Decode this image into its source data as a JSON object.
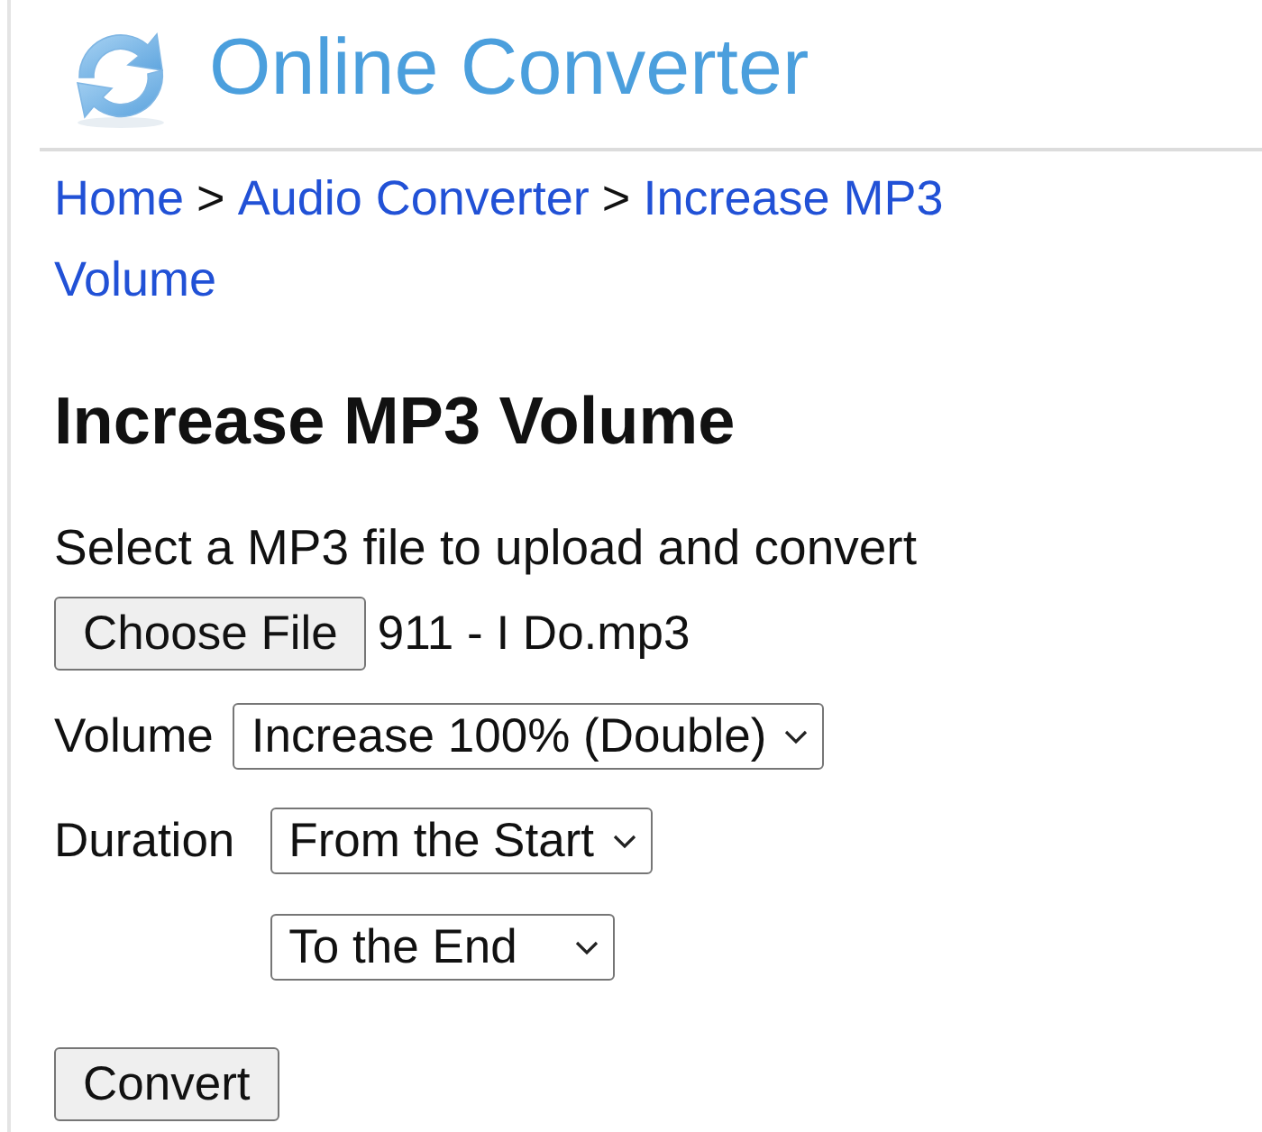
{
  "header": {
    "title": "Online Converter"
  },
  "breadcrumb": [
    {
      "kind": "link",
      "label": "Home"
    },
    {
      "kind": "separator",
      "label": ">"
    },
    {
      "kind": "link",
      "label": "Audio Converter"
    },
    {
      "kind": "separator",
      "label": ">"
    },
    {
      "kind": "link",
      "label": "Increase MP3"
    },
    {
      "kind": "link",
      "label": "Volume"
    }
  ],
  "heading": "Increase MP3 Volume",
  "upload": {
    "prompt": "Select a MP3 file to upload and convert",
    "button": "Choose File",
    "file_name": "911 - I Do.mp3"
  },
  "fields": [
    {
      "label": "Volume",
      "selects": [
        {
          "value": "Increase 100% (Double)"
        }
      ]
    },
    {
      "label": "Duration",
      "selects": [
        {
          "value": "From the Start"
        },
        {
          "value": "To the End"
        }
      ]
    }
  ],
  "submit": "Convert"
}
